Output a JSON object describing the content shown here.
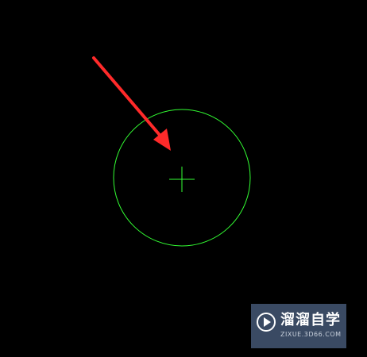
{
  "canvas": {
    "background": "#000000"
  },
  "drawing": {
    "circle_color": "#33ff33",
    "crosshair_color": "#33ff33"
  },
  "annotation": {
    "arrow_color": "#ff2a2a"
  },
  "watermark": {
    "icon": "play-logo-icon",
    "name": "溜溜自学",
    "url": "ZIXUE.3D66.COM",
    "background": "#3a4a63"
  }
}
